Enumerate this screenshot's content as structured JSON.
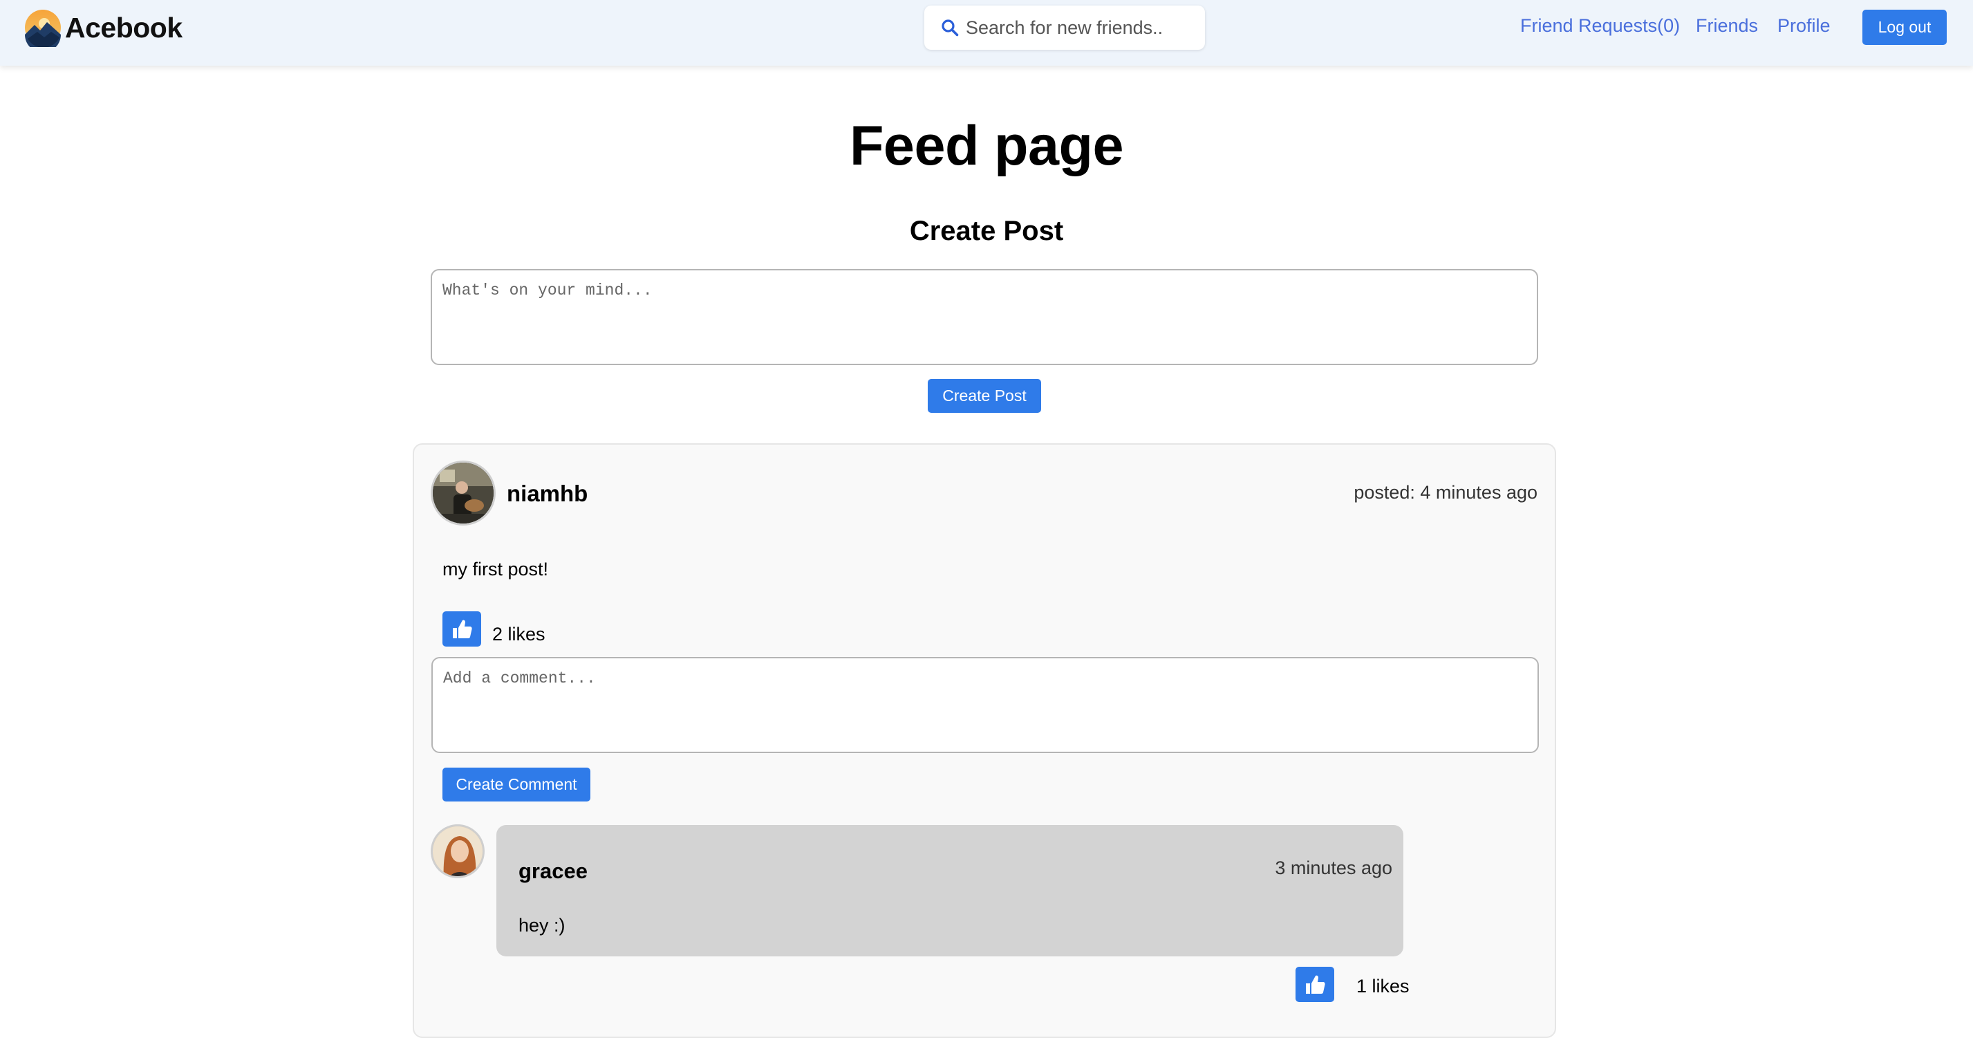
{
  "navbar": {
    "brand": "Acebook",
    "search_placeholder": "Search for new friends..",
    "links": {
      "friend_requests": "Friend Requests(0)",
      "friends": "Friends",
      "profile": "Profile"
    },
    "logout_label": "Log out"
  },
  "main": {
    "title": "Feed page",
    "create_post": {
      "heading": "Create Post",
      "placeholder": "What's on your mind...",
      "button_label": "Create Post"
    }
  },
  "post": {
    "username": "niamhb",
    "posted": "posted: 4 minutes ago",
    "content": "my first post!",
    "likes": "2 likes",
    "comment_placeholder": "Add a comment...",
    "comment_button": "Create Comment",
    "comments": [
      {
        "username": "gracee",
        "time": "3 minutes ago",
        "text": "hey :)",
        "likes": "1 likes"
      }
    ]
  },
  "colors": {
    "accent": "#2f7be9",
    "link": "#4a6fdc",
    "navbar_bg": "#eef4fb",
    "comment_bg": "#d3d3d3"
  },
  "icons": [
    "acebook-logo-icon",
    "search-icon",
    "thumbs-up-icon"
  ]
}
